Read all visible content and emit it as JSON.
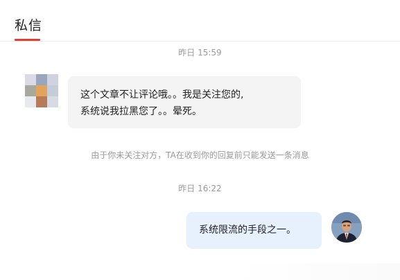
{
  "header": {
    "tab_label": "私信",
    "accent_color": "#e33e33"
  },
  "conversation": {
    "timestamp_1": "昨日 15:59",
    "incoming_message": {
      "line_1": "这个文章不让评论哦。。我是关注您的,",
      "line_2": "系统说我拉黑您了。。晕死。"
    },
    "notice": "由于你未关注对方，TA在收到你的回复前只能发送一条消息",
    "timestamp_2": "昨日 16:22",
    "outgoing_message": {
      "text": "系统限流的手段之一。",
      "bubble_color": "#e7f0fd"
    }
  },
  "icons": {
    "left_avatar": "pixelated-avatar-icon",
    "right_avatar": "user-avatar-icon"
  }
}
